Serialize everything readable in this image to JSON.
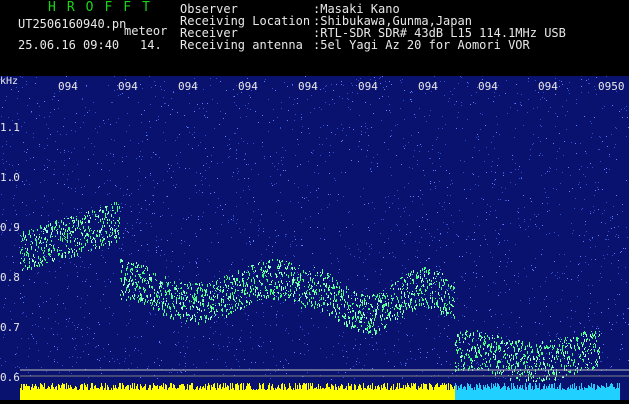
{
  "header": {
    "logo": "HROFFT",
    "filename": "UT2506160940.pn",
    "tag": "meteor",
    "datetime": "25.06.16 09:40",
    "counter": "14.",
    "info": [
      {
        "key": "Observer",
        "value": ":Masaki Kano"
      },
      {
        "key": "Receiving Location",
        "value": ":Shibukawa,Gunma,Japan"
      },
      {
        "key": "Receiver",
        "value": ":RTL-SDR SDR# 43dB L15 114.1MHz USB"
      },
      {
        "key": "Receiving antenna",
        "value": ":5el Yagi Az 20 for Aomori VOR"
      }
    ]
  },
  "spectrogram": {
    "y_unit": "kHz",
    "y_ticks": [
      "1.1",
      "1.0",
      "0.9",
      "0.8",
      "0.7",
      "0.6"
    ],
    "time_ticks": [
      "094",
      "094",
      "094",
      "094",
      "094",
      "094",
      "094",
      "094",
      "094",
      "0950"
    ],
    "colors": {
      "background": "#0a1270",
      "noise": "#3050d0",
      "signal": "#40ff80",
      "level_yellow": "#ffff00",
      "level_cyan": "#20d0ff"
    }
  }
}
